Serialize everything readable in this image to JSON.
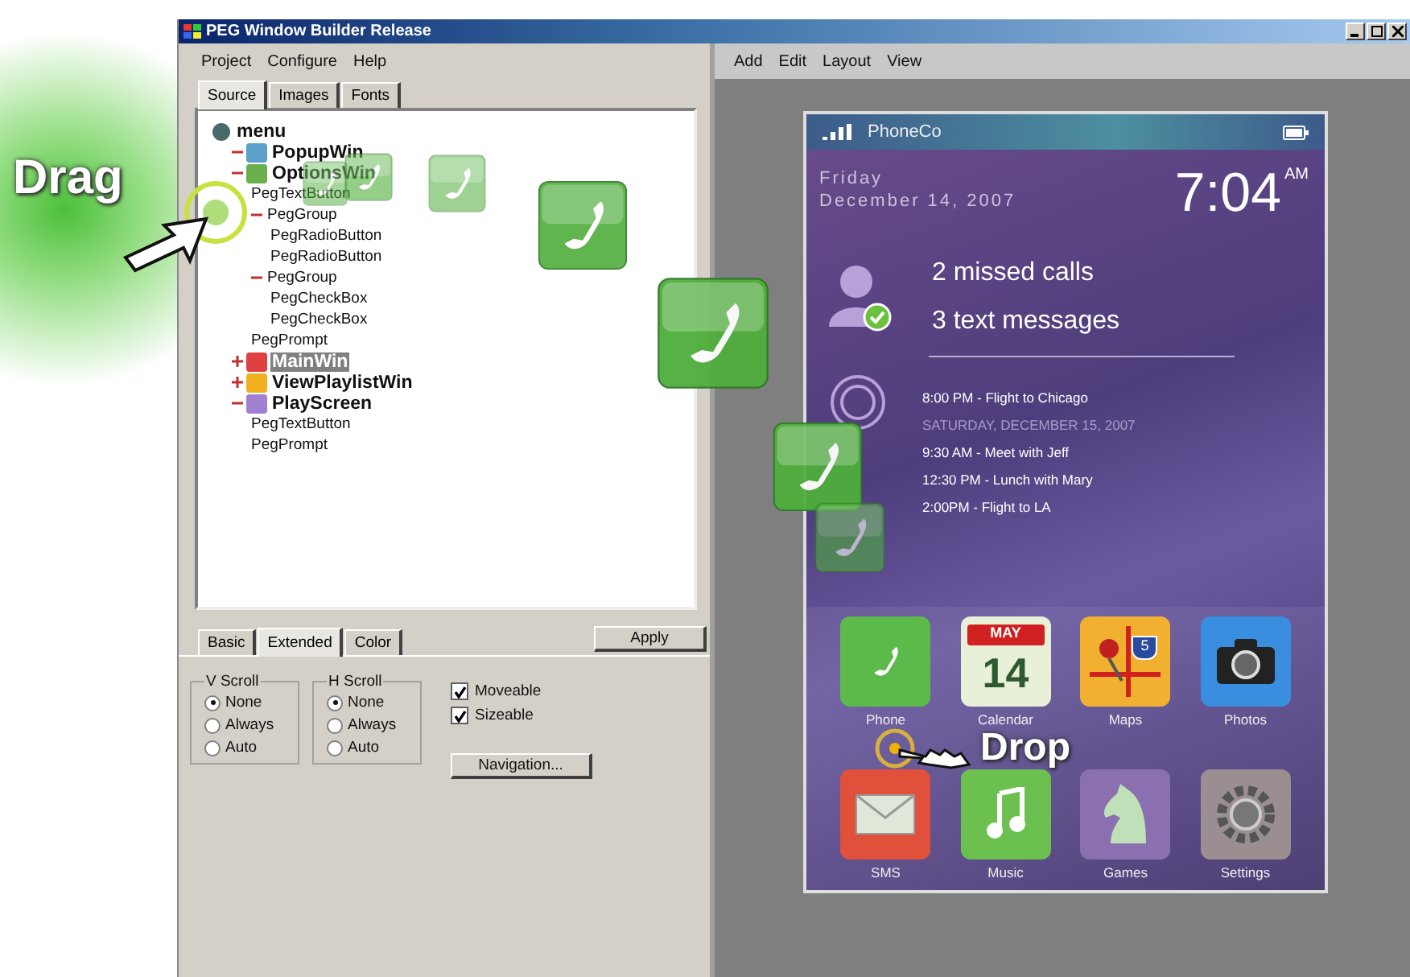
{
  "window": {
    "title": "PEG Window Builder Release"
  },
  "left_menu": [
    "Project",
    "Configure",
    "Help"
  ],
  "source_tabs": [
    {
      "label": "Source",
      "selected": true
    },
    {
      "label": "Images",
      "selected": false
    },
    {
      "label": "Fonts",
      "selected": false
    }
  ],
  "tree": [
    {
      "label": "menu",
      "kind": "root",
      "color": "#4a6a6a",
      "selected": false,
      "children": [
        {
          "label": "PopupWin",
          "kind": "window",
          "color": "#5aa0c8",
          "selected": false,
          "expanded": true
        },
        {
          "label": "OptionsWin",
          "kind": "window",
          "color": "#6ab04a",
          "selected": false,
          "expanded": true,
          "children": [
            {
              "label": "PegTextButton",
              "kind": "widget",
              "selected": false
            },
            {
              "label": "PegGroup",
              "kind": "widget",
              "selected": false,
              "expanded": true,
              "children": [
                {
                  "label": "PegRadioButton",
                  "kind": "widget",
                  "selected": false
                },
                {
                  "label": "PegRadioButton",
                  "kind": "widget",
                  "selected": false
                }
              ]
            },
            {
              "label": "PegGroup",
              "kind": "widget",
              "selected": false,
              "expanded": true,
              "children": [
                {
                  "label": "PegCheckBox",
                  "kind": "widget",
                  "selected": false
                },
                {
                  "label": "PegCheckBox",
                  "kind": "widget",
                  "selected": false
                }
              ]
            },
            {
              "label": "PegPrompt",
              "kind": "widget",
              "selected": false
            }
          ]
        },
        {
          "label": "MainWin",
          "kind": "window",
          "color": "#e04040",
          "selected": true,
          "expanded": false
        },
        {
          "label": "ViewPlaylistWin",
          "kind": "window",
          "color": "#f0b020",
          "selected": false,
          "expanded": false
        },
        {
          "label": "PlayScreen",
          "kind": "window",
          "color": "#a080d0",
          "selected": false,
          "expanded": true,
          "children": [
            {
              "label": "PegTextButton",
              "kind": "widget",
              "selected": false
            },
            {
              "label": "PegPrompt",
              "kind": "widget",
              "selected": false
            }
          ]
        }
      ]
    }
  ],
  "prop_tabs": [
    {
      "label": "Basic",
      "selected": false
    },
    {
      "label": "Extended",
      "selected": true
    },
    {
      "label": "Color",
      "selected": false
    }
  ],
  "apply_button": "Apply",
  "scroll_groups": [
    {
      "title": "V Scroll",
      "options": [
        {
          "label": "None",
          "selected": true
        },
        {
          "label": "Always",
          "selected": false
        },
        {
          "label": "Auto",
          "selected": false
        }
      ]
    },
    {
      "title": "H Scroll",
      "options": [
        {
          "label": "None",
          "selected": true
        },
        {
          "label": "Always",
          "selected": false
        },
        {
          "label": "Auto",
          "selected": false
        }
      ]
    }
  ],
  "checkboxes": [
    {
      "label": "Moveable",
      "checked": true
    },
    {
      "label": "Sizeable",
      "checked": true
    }
  ],
  "navigation_button": "Navigation...",
  "right_menu": [
    "Add",
    "Edit",
    "Layout",
    "View"
  ],
  "phone": {
    "carrier": "PhoneCo",
    "day": "Friday",
    "date": "December 14, 2007",
    "time": "7:04",
    "ampm": "AM",
    "notifications": [
      "2 missed calls",
      "3 text messages"
    ],
    "agenda": [
      {
        "kind": "event",
        "text": "8:00 PM - Flight to Chicago"
      },
      {
        "kind": "date",
        "text": "SATURDAY, DECEMBER 15, 2007"
      },
      {
        "kind": "event",
        "text": "9:30 AM - Meet with Jeff"
      },
      {
        "kind": "event",
        "text": "12:30 PM - Lunch with Mary"
      },
      {
        "kind": "event",
        "text": "2:00PM - Flight to LA"
      }
    ],
    "apps": [
      {
        "kind": "phone",
        "label": "Phone"
      },
      {
        "kind": "calendar",
        "label": "Calendar",
        "month": "MAY",
        "day": "14"
      },
      {
        "kind": "maps",
        "label": "Maps",
        "shield": "5"
      },
      {
        "kind": "camera",
        "label": "Photos"
      },
      {
        "kind": "sms",
        "label": "SMS"
      },
      {
        "kind": "music",
        "label": "Music"
      },
      {
        "kind": "games",
        "label": "Games"
      },
      {
        "kind": "settings",
        "label": "Settings"
      }
    ]
  },
  "overlay": {
    "drag_label": "Drag",
    "drop_label": "Drop"
  }
}
